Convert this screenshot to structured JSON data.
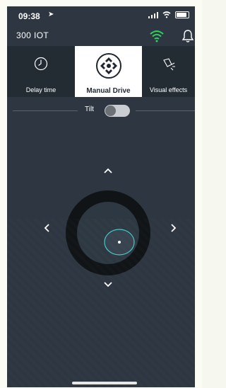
{
  "status": {
    "time": "09:38",
    "signal": "signal-bars-icon",
    "wifi": "wifi-icon",
    "battery": "battery-icon"
  },
  "header": {
    "title": "300 IOT",
    "wifi_icon": "wifi-icon",
    "bell_icon": "bell-icon",
    "wifi_color": "#2fd05f"
  },
  "tabs": [
    {
      "label": "Delay time",
      "icon": "clock-icon"
    },
    {
      "label": "Manual Drive",
      "icon": "gamepad-icon"
    },
    {
      "label": "Visual effects",
      "icon": "sparkle-icon"
    }
  ],
  "tilt": {
    "label": "Tilt",
    "state": false
  },
  "controls": {
    "up": "^",
    "down": "v",
    "left": "<",
    "right": ">"
  },
  "colors": {
    "background": "#2d3641",
    "tab_bar": "#232b33",
    "accent": "#2fd05f"
  }
}
